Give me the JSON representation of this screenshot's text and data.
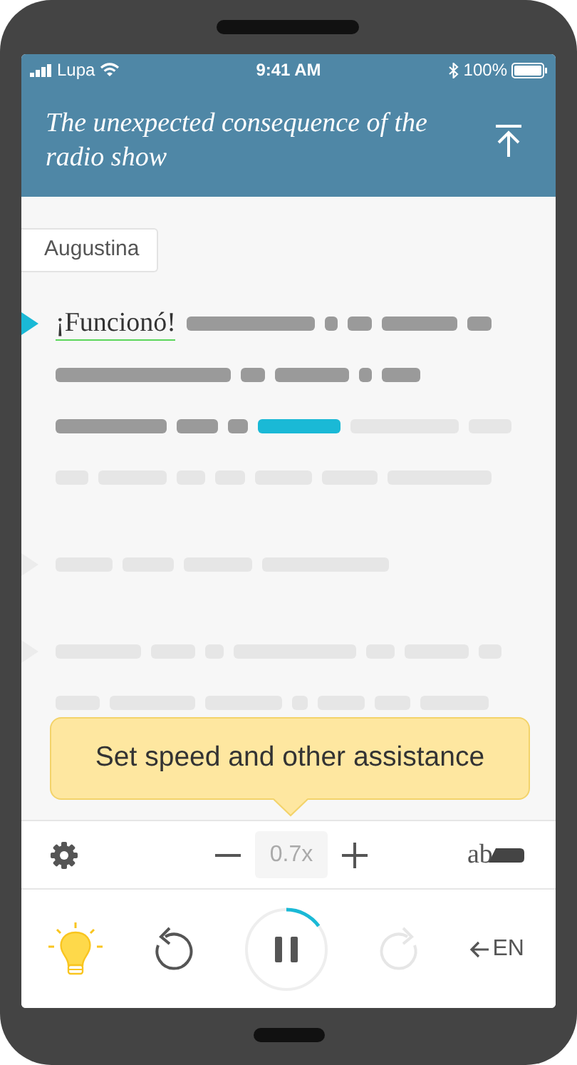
{
  "status_bar": {
    "carrier": "Lupa",
    "time": "9:41 AM",
    "battery": "100%"
  },
  "header": {
    "title": "The unexpected consequence of the radio show"
  },
  "speaker": "Augustina",
  "paragraphs": [
    {
      "active": true,
      "first_word": "¡Funcionó!",
      "lines": [
        [
          {
            "spoken": true,
            "current": false
          },
          {
            "spoken": true,
            "current": false
          },
          {
            "spoken": true,
            "current": false
          },
          {
            "spoken": true,
            "current": false
          },
          {
            "spoken": true,
            "current": false
          }
        ],
        [
          {
            "spoken": true,
            "current": false
          },
          {
            "spoken": true,
            "current": false
          },
          {
            "spoken": true,
            "current": false
          },
          {
            "spoken": true,
            "current": false
          },
          {
            "spoken": true,
            "current": false
          }
        ],
        [
          {
            "spoken": true,
            "current": false
          },
          {
            "spoken": true,
            "current": false
          },
          {
            "spoken": true,
            "current": false
          },
          {
            "spoken": false,
            "current": true
          },
          {
            "spoken": false,
            "current": false
          },
          {
            "spoken": false,
            "current": false
          }
        ],
        [
          {
            "spoken": false,
            "current": false
          },
          {
            "spoken": false,
            "current": false
          },
          {
            "spoken": false,
            "current": false
          },
          {
            "spoken": false,
            "current": false
          },
          {
            "spoken": false,
            "current": false
          },
          {
            "spoken": false,
            "current": false
          },
          {
            "spoken": false,
            "current": false
          }
        ]
      ]
    },
    {
      "active": false,
      "lines": [
        [
          {
            "spoken": false,
            "current": false
          },
          {
            "spoken": false,
            "current": false
          },
          {
            "spoken": false,
            "current": false
          },
          {
            "spoken": false,
            "current": false
          }
        ]
      ]
    },
    {
      "active": false,
      "lines": [
        [
          {
            "spoken": false,
            "current": false
          },
          {
            "spoken": false,
            "current": false
          },
          {
            "spoken": false,
            "current": false
          },
          {
            "spoken": false,
            "current": false
          },
          {
            "spoken": false,
            "current": false
          },
          {
            "spoken": false,
            "current": false
          },
          {
            "spoken": false,
            "current": false
          }
        ],
        [
          {
            "spoken": false,
            "current": false
          },
          {
            "spoken": false,
            "current": false
          },
          {
            "spoken": false,
            "current": false
          },
          {
            "spoken": false,
            "current": false
          },
          {
            "spoken": false,
            "current": false
          },
          {
            "spoken": false,
            "current": false
          },
          {
            "spoken": false,
            "current": false
          }
        ]
      ]
    }
  ],
  "tooltip": "Set speed and other assistance",
  "toolbar": {
    "speed": "0.7x",
    "highlight_label": "ab"
  },
  "player": {
    "hint_on": true,
    "playing": true,
    "forward_disabled": true,
    "language": "EN"
  }
}
